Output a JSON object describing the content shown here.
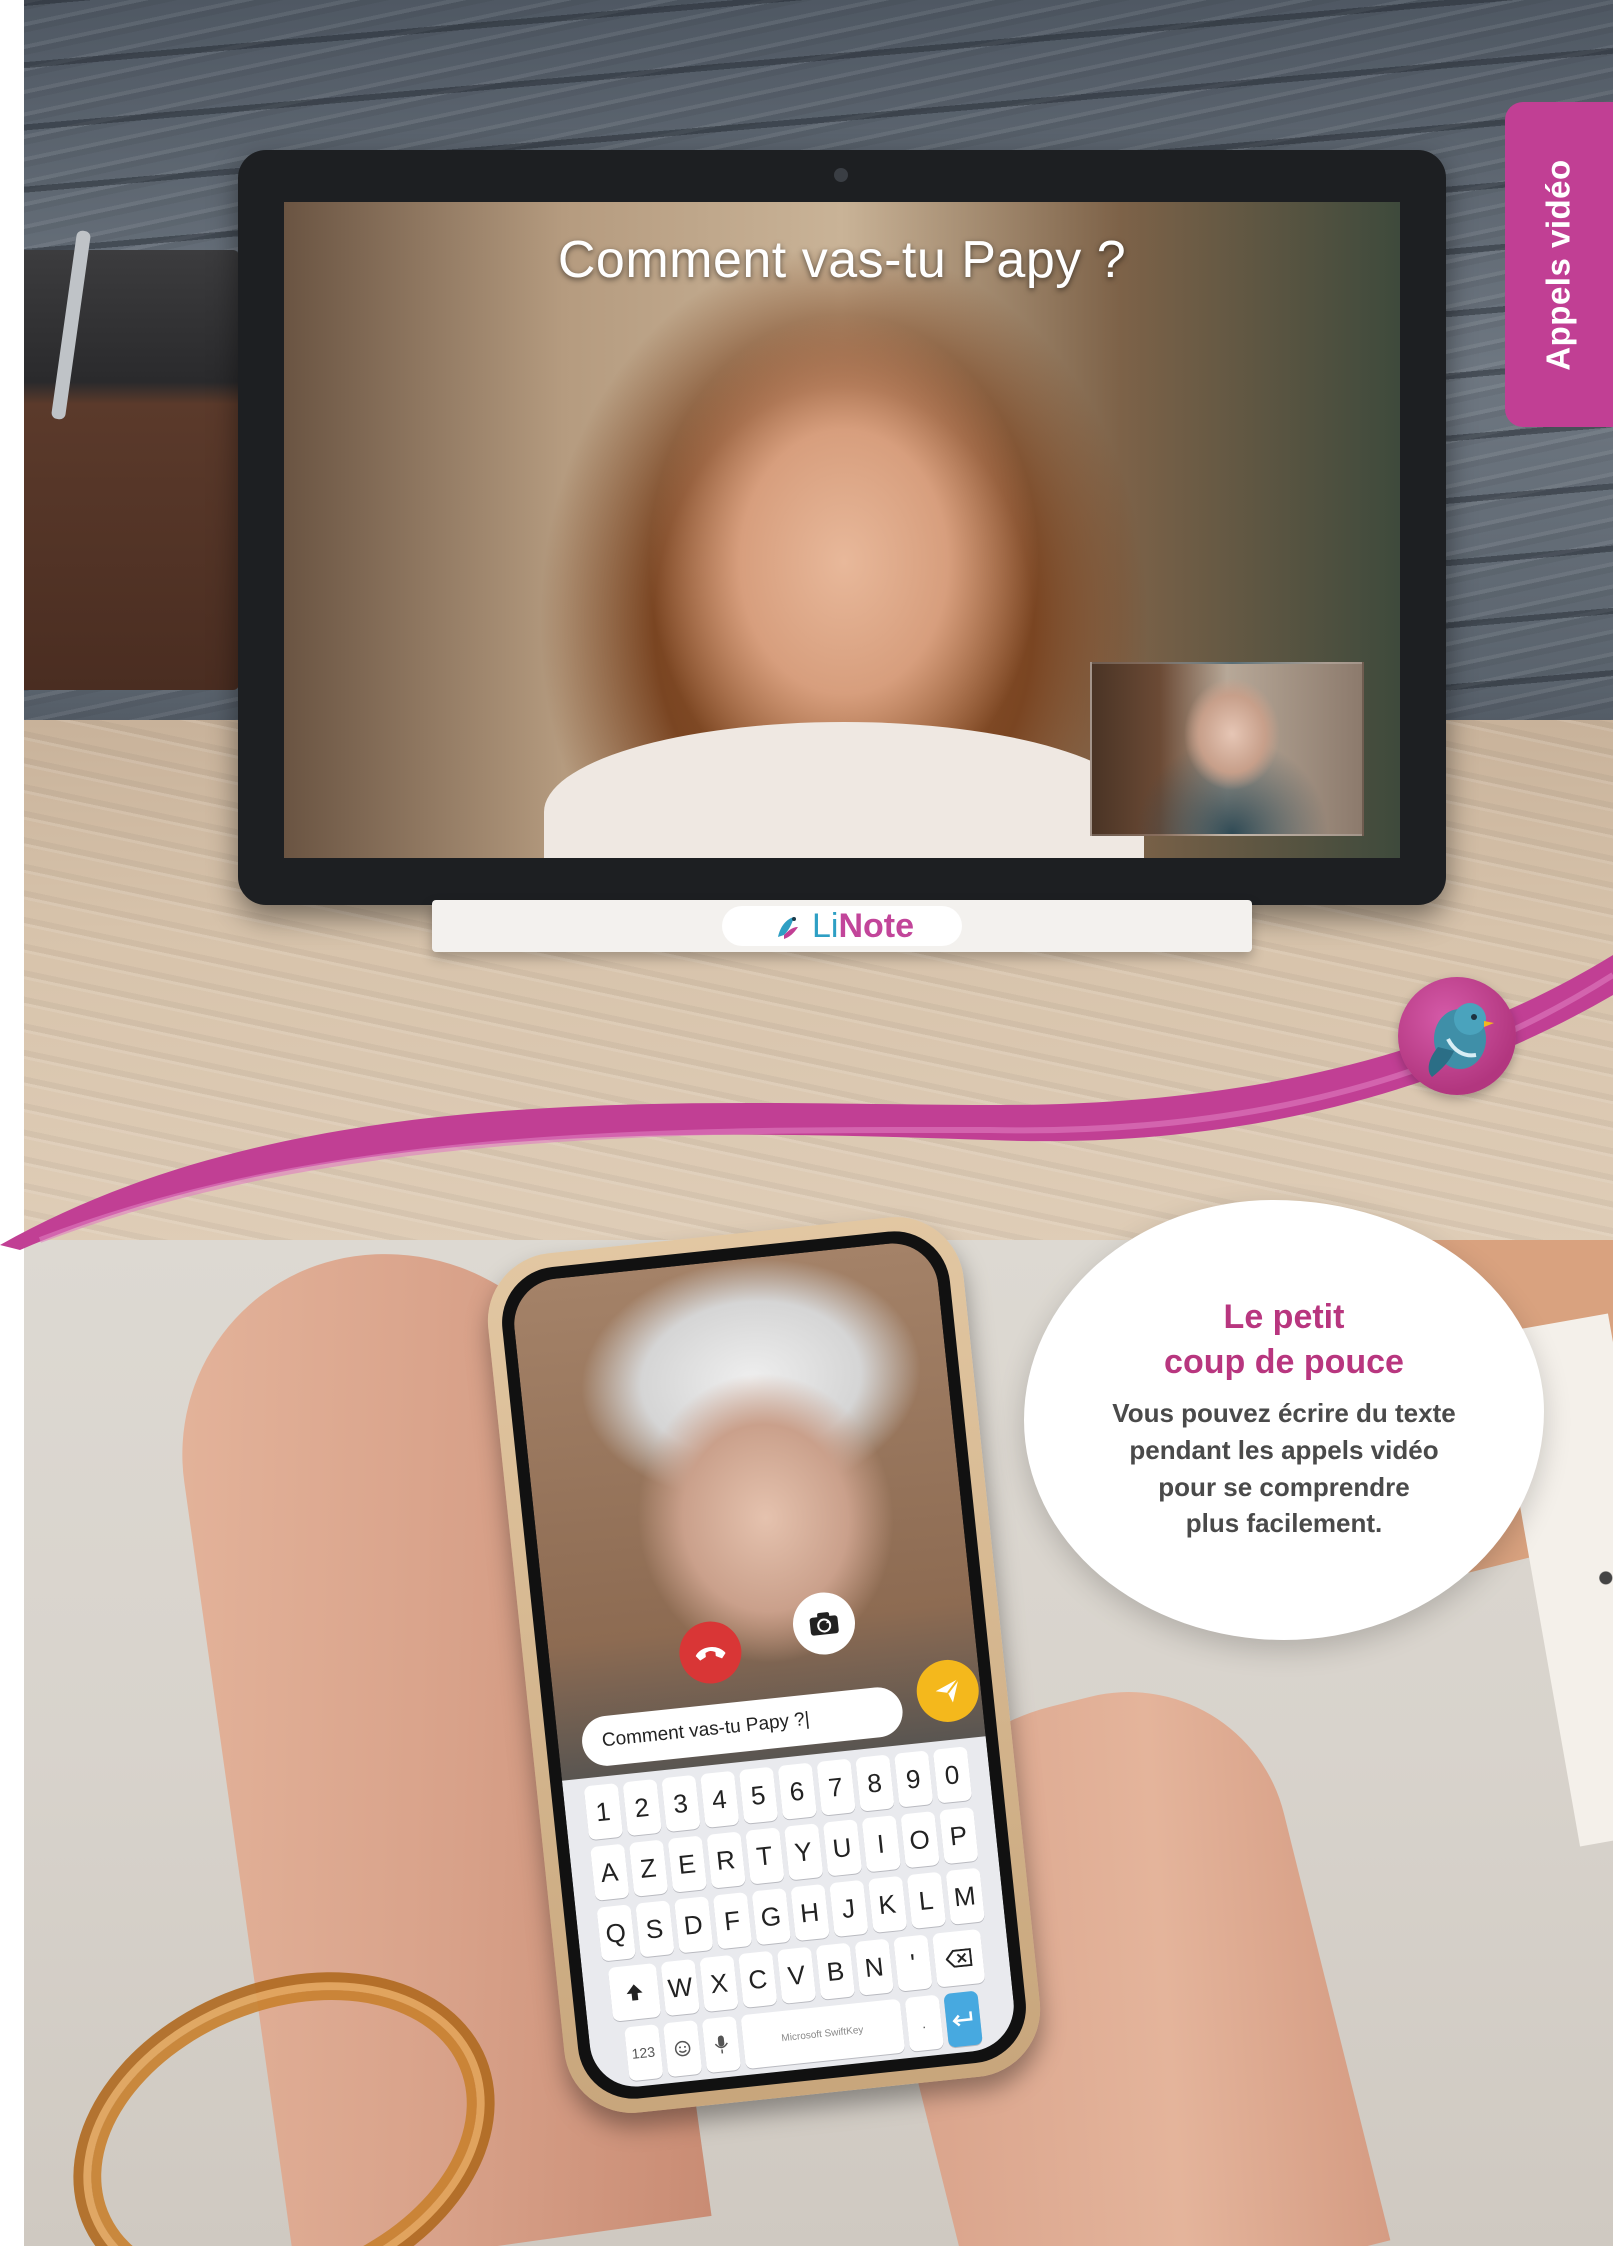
{
  "side_tab": {
    "label": "Appels vidéo"
  },
  "tablet": {
    "caption": "Comment vas-tu Papy ?"
  },
  "brand": {
    "prefix": "Li",
    "suffix": "Note"
  },
  "phone": {
    "message_field": "Comment vas-tu Papy ?|",
    "icons": {
      "hangup": "phone-hangup-icon",
      "flip": "camera-flip-icon",
      "send": "send-icon"
    },
    "keyboard": {
      "row1": [
        "1",
        "2",
        "3",
        "4",
        "5",
        "6",
        "7",
        "8",
        "9",
        "0"
      ],
      "row2": [
        "A",
        "Z",
        "E",
        "R",
        "T",
        "Y",
        "U",
        "I",
        "O",
        "P"
      ],
      "row3": [
        "Q",
        "S",
        "D",
        "F",
        "G",
        "H",
        "J",
        "K",
        "L",
        "M"
      ],
      "row4": [
        "W",
        "X",
        "C",
        "V",
        "B",
        "N",
        "'"
      ],
      "bottom": {
        "numbers": "123",
        "space": "Microsoft SwiftKey",
        "period": "."
      }
    }
  },
  "tip": {
    "title_line1": "Le petit",
    "title_line2": "coup de pouce",
    "body_line1": "Vous pouvez écrire du texte",
    "body_line2": "pendant les appels vidéo",
    "body_line3": "pour se comprendre",
    "body_line4": "plus facilement."
  },
  "colors": {
    "brand_magenta": "#c13f94",
    "brand_blue": "#2e9fc4",
    "hangup_red": "#d93636",
    "send_yellow": "#f4b81c"
  }
}
